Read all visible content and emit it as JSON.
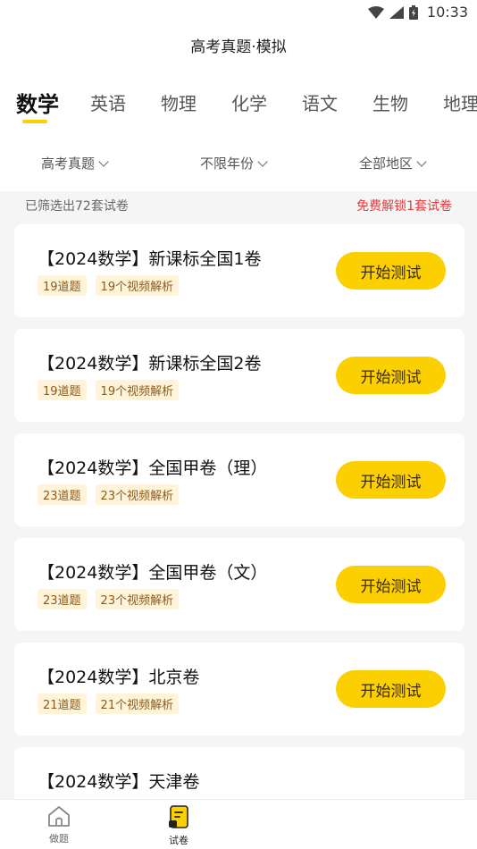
{
  "status_bar": {
    "time": "10:33"
  },
  "header": {
    "title": "高考真题·模拟"
  },
  "tabs": [
    {
      "label": "数学",
      "active": true
    },
    {
      "label": "英语",
      "active": false
    },
    {
      "label": "物理",
      "active": false
    },
    {
      "label": "化学",
      "active": false
    },
    {
      "label": "语文",
      "active": false
    },
    {
      "label": "生物",
      "active": false
    },
    {
      "label": "地理",
      "active": false
    }
  ],
  "filters": [
    {
      "label": "高考真题"
    },
    {
      "label": "不限年份"
    },
    {
      "label": "全部地区"
    }
  ],
  "summary": {
    "count_text": "已筛选出72套试卷",
    "unlock_text": "免费解锁1套试卷"
  },
  "papers": [
    {
      "title": "【2024数学】新课标全国1卷",
      "questions": "19道题",
      "videos": "19个视频解析",
      "button": "开始测试"
    },
    {
      "title": "【2024数学】新课标全国2卷",
      "questions": "19道题",
      "videos": "19个视频解析",
      "button": "开始测试"
    },
    {
      "title": "【2024数学】全国甲卷（理）",
      "questions": "23道题",
      "videos": "23个视频解析",
      "button": "开始测试"
    },
    {
      "title": "【2024数学】全国甲卷（文）",
      "questions": "23道题",
      "videos": "23个视频解析",
      "button": "开始测试"
    },
    {
      "title": "【2024数学】北京卷",
      "questions": "21道题",
      "videos": "21个视频解析",
      "button": "开始测试"
    },
    {
      "title": "【2024数学】天津卷",
      "questions": "",
      "videos": "",
      "button": ""
    }
  ],
  "bottom_nav": [
    {
      "label": "做题",
      "icon": "home-icon",
      "active": false
    },
    {
      "label": "试卷",
      "icon": "paper-icon",
      "active": true
    }
  ],
  "colors": {
    "accent": "#fcd000",
    "unlock_red": "#e8383d",
    "tag_bg": "#fff4d8",
    "tag_text": "#8a5a1e"
  }
}
